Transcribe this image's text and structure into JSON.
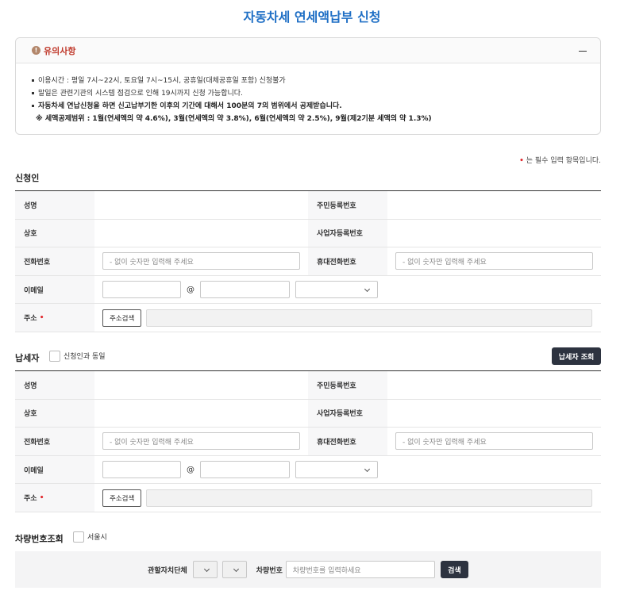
{
  "page": {
    "title": "자동차세 연세액납부 신청"
  },
  "notice": {
    "title": "유의사항",
    "lines": [
      "이용시간 : 평일 7시~22시, 토요일 7시~15시, 공휴일(대체공휴일 포함) 신청불가",
      "말일은 관련기관의 시스템 점검으로 인해 19시까지 신청 가능합니다.",
      "자동차세 연납신청을 하면 신고납부기한 이후의 기간에 대해서 100분의 7의 범위에서 공제받습니다."
    ],
    "sub_line": "※  세액공제범위 : 1월(연세액의 약 4.6%), 3월(연세액의 약 3.8%), 6월(연세액의 약 2.5%), 9월(제2기분 세액의 약 1.3%)"
  },
  "required_note": {
    "mark": "•",
    "text": " 는 필수 입력 항목입니다."
  },
  "applicant": {
    "section_title": "신청인",
    "name_label": "성명",
    "rrn_label": "주민등록번호",
    "company_label": "상호",
    "brn_label": "사업자등록번호",
    "phone_label": "전화번호",
    "phone_placeholder": "- 없이 숫자만 입력해 주세요",
    "mobile_label": "휴대전화번호",
    "mobile_placeholder": "- 없이 숫자만 입력해 주세요",
    "email_label": "이메일",
    "at_sign": "@",
    "address_label": "주소",
    "address_search": "주소검색"
  },
  "taxpayer": {
    "section_title": "납세자",
    "same_label": "신청인과 동일",
    "lookup_button": "납세자 조회",
    "name_label": "성명",
    "rrn_label": "주민등록번호",
    "company_label": "상호",
    "brn_label": "사업자등록번호",
    "phone_label": "전화번호",
    "phone_placeholder": "- 없이 숫자만 입력해 주세요",
    "mobile_label": "휴대전화번호",
    "mobile_placeholder": "- 없이 숫자만 입력해 주세요",
    "email_label": "이메일",
    "at_sign": "@",
    "address_label": "주소",
    "address_search": "주소검색"
  },
  "vehicle": {
    "section_title": "차량번호조회",
    "seoul_label": "서울시",
    "jurisdiction_label": "관할자치단체",
    "plate_label": "차량번호",
    "plate_placeholder": "차량번호를 입력하세요",
    "search_button": "검색"
  },
  "colors": {
    "title_blue": "#1f6fc5",
    "notice_red": "#c0392b",
    "required_red": "#e0272c",
    "dark_button": "#2d3340"
  }
}
